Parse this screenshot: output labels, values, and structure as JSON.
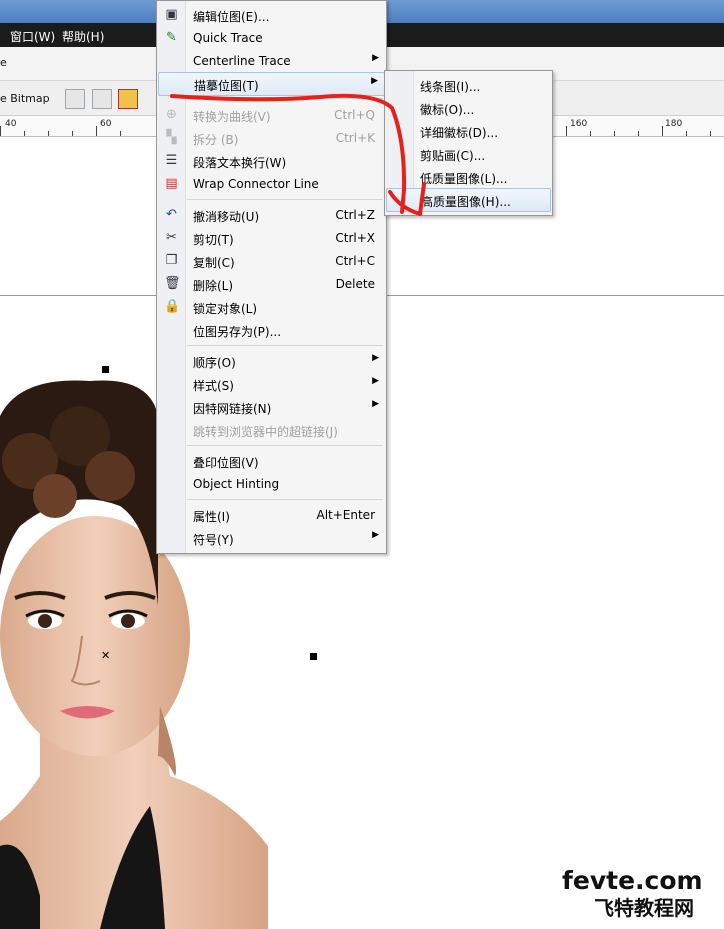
{
  "menubar": {
    "window": "窗口(W)",
    "help": "帮助(H)"
  },
  "toolbar": {
    "left_fragment": "e",
    "bitmap_label": "e Bitmap"
  },
  "ruler": {
    "labels": [
      "40",
      "60",
      "160",
      "180"
    ]
  },
  "context_menu": {
    "items": [
      {
        "label": "编辑位图(E)...",
        "icon": "edit-bitmap-icon"
      },
      {
        "label": "Quick Trace",
        "icon": "quick-trace-icon"
      },
      {
        "label": "Centerline Trace",
        "has_submenu": true
      },
      {
        "label": "描摹位图(T)",
        "has_submenu": true,
        "highlighted": true
      },
      {
        "label": "转换为曲线(V)",
        "shortcut": "Ctrl+Q",
        "disabled": true,
        "icon": "convert-curves-icon"
      },
      {
        "label": "拆分 (B)",
        "shortcut": "Ctrl+K",
        "disabled": true,
        "icon": "break-apart-icon"
      },
      {
        "label": "段落文本换行(W)",
        "icon": "text-wrap-icon"
      },
      {
        "label": "Wrap Connector Line",
        "icon": "wrap-connector-icon"
      },
      {
        "label": "撤消移动(U)",
        "shortcut": "Ctrl+Z",
        "icon": "undo-icon"
      },
      {
        "label": "剪切(T)",
        "shortcut": "Ctrl+X",
        "icon": "scissors-icon"
      },
      {
        "label": "复制(C)",
        "shortcut": "Ctrl+C",
        "icon": "copy-icon"
      },
      {
        "label": "删除(L)",
        "shortcut": "Delete",
        "icon": "trash-icon"
      },
      {
        "label": "锁定对象(L)",
        "icon": "lock-icon"
      },
      {
        "label": "位图另存为(P)..."
      },
      {
        "label": "顺序(O)",
        "has_submenu": true
      },
      {
        "label": "样式(S)",
        "has_submenu": true
      },
      {
        "label": "因特网链接(N)",
        "has_submenu": true
      },
      {
        "label": "跳转到浏览器中的超链接(J)",
        "disabled": true
      },
      {
        "label": "叠印位图(V)"
      },
      {
        "label": "Object Hinting"
      },
      {
        "label": "属性(I)",
        "shortcut": "Alt+Enter"
      },
      {
        "label": "符号(Y)",
        "has_submenu": true
      }
    ]
  },
  "submenu": {
    "items": [
      "线条图(I)...",
      "徽标(O)...",
      "详细徽标(D)...",
      "剪贴画(C)...",
      "低质量图像(L)...",
      "高质量图像(H)..."
    ],
    "highlighted_index": 5
  },
  "watermark": {
    "line1": "fevte.com",
    "line2": "飞特教程网"
  },
  "colors": {
    "annotation_red": "#e8201c",
    "highlight": "#dfeaf6",
    "menubar": "#1b1b1b"
  }
}
